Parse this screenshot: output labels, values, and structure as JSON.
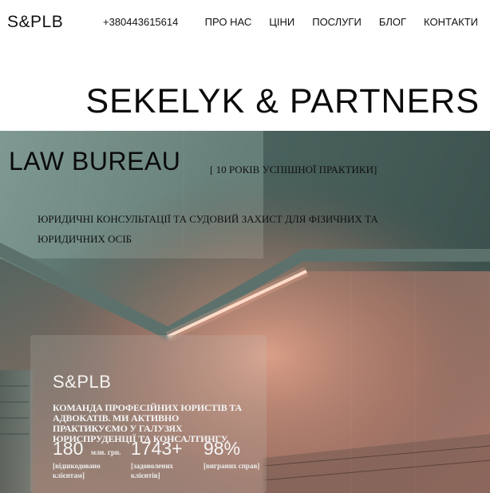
{
  "header": {
    "logo": "S&PLB",
    "phone": "+380443615614",
    "nav": [
      {
        "label": "ПРО НАС"
      },
      {
        "label": "ЦІНИ"
      },
      {
        "label": "ПОСЛУГИ"
      },
      {
        "label": "БЛОГ"
      },
      {
        "label": "КОНТАКТИ"
      }
    ]
  },
  "hero": {
    "title": "SEKELYK & PARTNERS",
    "subtitle": "LAW BUREAU",
    "tagline": "[ 10 РОКІВ УСПІШНОЇ ПРАКТИКИ]",
    "description": "ЮРИДИЧНІ КОНСУЛЬТАЦІЇ ТА СУДОВИЙ ЗАХИСТ ДЛЯ ФІЗИЧНИХ ТА ЮРИДИЧНИХ ОСІБ"
  },
  "card": {
    "logo": "S&PLB",
    "text": "КОМАНДА ПРОФЕСІЙНИХ ЮРИСТІВ ТА АДВОКАТІВ. МИ АКТИВНО ПРАКТИКУЄМО У ГАЛУЗЯХ ЮРИСПРУДЕНЦІЇ ТА КОНСАЛТИНГУ.",
    "stats": [
      {
        "value": "180",
        "unit": "млн. грн.",
        "label": "[відшкодовано клієнтам]"
      },
      {
        "value": "1743+",
        "unit": "",
        "label": "[задоволених клієнтів]"
      },
      {
        "value": "98%",
        "unit": "",
        "label": "[виграних справ]"
      }
    ]
  },
  "colors": {
    "wall_dark": "#3f5752",
    "wall_light": "#7e9a93",
    "warm_glow": "#c98a72",
    "led_strip": "#ffe2d0"
  }
}
